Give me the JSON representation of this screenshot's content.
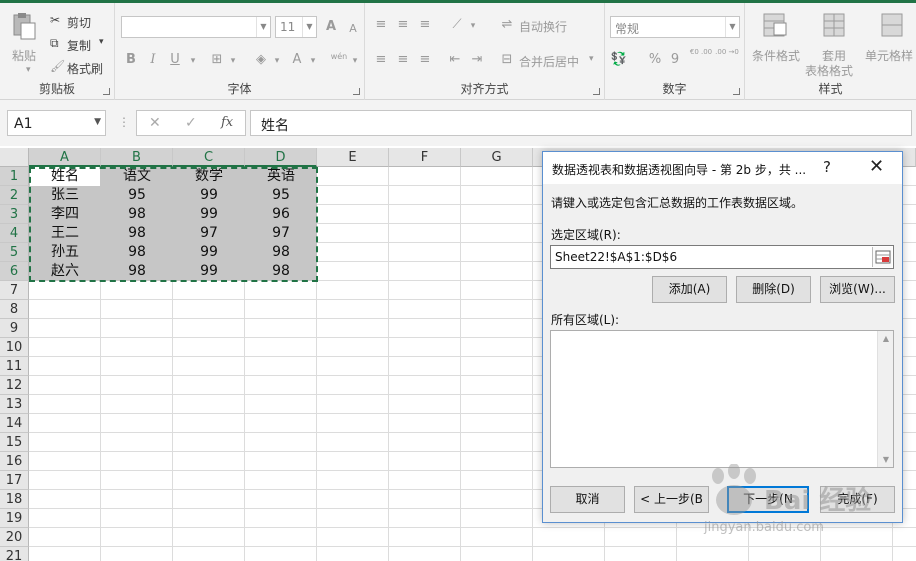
{
  "ribbon": {
    "clipboard": {
      "paste": "粘贴",
      "cut": "剪切",
      "copy": "复制",
      "format_painter": "格式刷",
      "label": "剪贴板"
    },
    "font": {
      "label": "字体",
      "size": "11",
      "bold": "B",
      "italic": "I",
      "underline": "U",
      "grow": "A",
      "shrink": "A",
      "font_color": "A",
      "wen": "wén"
    },
    "alignment": {
      "label": "对齐方式",
      "wrap": "自动换行",
      "merge": "合并后居中"
    },
    "number": {
      "label": "数字",
      "format": "常规",
      "percent": "%",
      "comma": "9",
      "inc": "€0 .00",
      "dec": ".00 →0"
    },
    "styles": {
      "label": "样式",
      "conditional": "条件格式",
      "table1": "套用",
      "table2": "表格格式",
      "cell_styles": "单元格样"
    }
  },
  "formula_bar": {
    "name_box": "A1",
    "cancel": "✕",
    "confirm": "✓",
    "fx": "fx",
    "content": "姓名"
  },
  "sheet": {
    "columns": [
      "A",
      "B",
      "C",
      "D",
      "E",
      "F",
      "G"
    ],
    "rows": [
      "1",
      "2",
      "3",
      "4",
      "5",
      "6",
      "7",
      "8",
      "9",
      "10",
      "11",
      "12",
      "13",
      "14",
      "15",
      "16",
      "17",
      "18",
      "19",
      "20",
      "21"
    ],
    "data": [
      [
        "姓名",
        "语文",
        "数学",
        "英语"
      ],
      [
        "张三",
        "95",
        "99",
        "95"
      ],
      [
        "李四",
        "98",
        "99",
        "96"
      ],
      [
        "王二",
        "98",
        "97",
        "97"
      ],
      [
        "孙五",
        "98",
        "99",
        "98"
      ],
      [
        "赵六",
        "98",
        "99",
        "98"
      ]
    ]
  },
  "dialog": {
    "title": "数据透视表和数据透视图向导 - 第 2b 步，共 ...",
    "help": "?",
    "close": "✕",
    "instruction": "请键入或选定包含汇总数据的工作表数据区域。",
    "range_label": "选定区域(R):",
    "range_value": "Sheet22!$A$1:$D$6",
    "add": "添加(A)",
    "delete": "删除(D)",
    "browse": "浏览(W)...",
    "all_ranges_label": "所有区域(L):",
    "cancel": "取消",
    "back": "< 上一步(B",
    "next": "下一步(N",
    "finish": "完成(F)"
  },
  "watermark": {
    "text1": "Bai 经验",
    "text2": "jingyan.baidu.com"
  }
}
